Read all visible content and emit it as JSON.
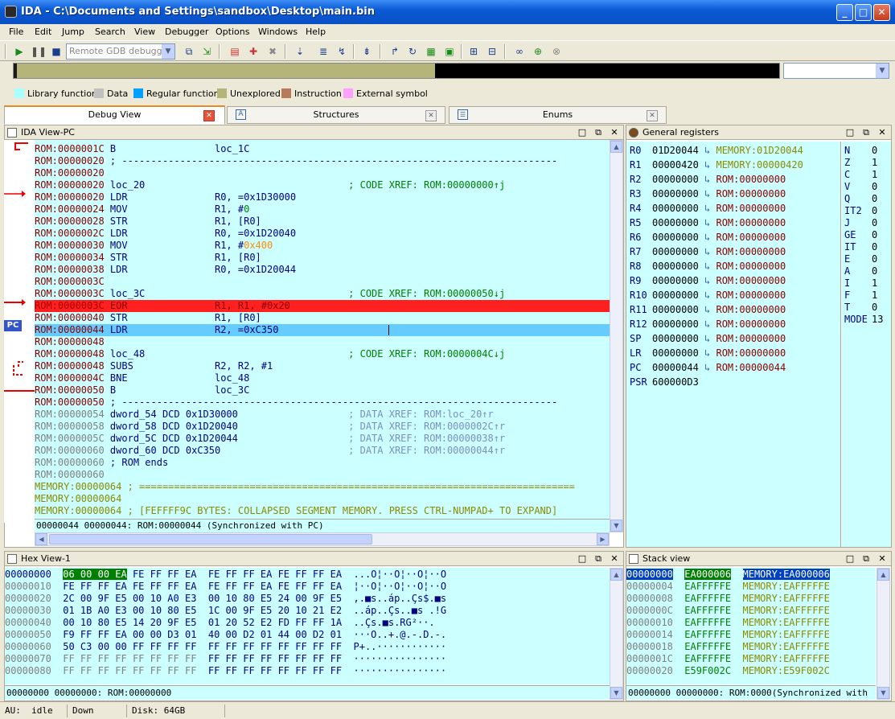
{
  "window": {
    "title": "IDA - C:\\Documents and Settings\\sandbox\\Desktop\\main.bin",
    "min": "_",
    "max": "□",
    "close": "✕"
  },
  "menu": [
    "File",
    "Edit",
    "Jump",
    "Search",
    "View",
    "Debugger",
    "Options",
    "Windows",
    "Help"
  ],
  "toolbar": {
    "debugger_select": "Remote GDB debugger"
  },
  "legend": [
    {
      "label": "Library function",
      "color": "#aaffff"
    },
    {
      "label": "Data",
      "color": "#c0c0c0"
    },
    {
      "label": "Regular function",
      "color": "#00a0ff"
    },
    {
      "label": "Unexplored",
      "color": "#b5b57a"
    },
    {
      "label": "Instruction",
      "color": "#b57b5a"
    },
    {
      "label": "External symbol",
      "color": "#ffa0ff"
    }
  ],
  "tabs": [
    {
      "label": "Debug View"
    },
    {
      "label": "Structures"
    },
    {
      "label": "Enums"
    }
  ],
  "ida_view": {
    "title": "IDA View-PC",
    "pc_label": "PC",
    "status": "00000044 00000044: ROM:00000044 (Synchronized with PC)",
    "lines": [
      {
        "addr": "ROM:0000001C",
        "text": " B                 loc_1C",
        "ac": "c-addr"
      },
      {
        "addr": "ROM:00000020",
        "text": " ; ---------------------------------------------------------------------------",
        "ac": "c-addr"
      },
      {
        "addr": "ROM:00000020",
        "text": "",
        "ac": "c-addr"
      },
      {
        "addr": "ROM:00000020",
        "text": " loc_20                                   ",
        "cmt": "; CODE XREF: ROM:00000000↑j",
        "ac": "c-addr"
      },
      {
        "addr": "ROM:00000020",
        "text": " LDR               R0, =0x1D30000",
        "ac": "c-addr"
      },
      {
        "addr": "ROM:00000024",
        "text": " MOV               R1, #",
        "num": "0",
        "ac": "c-addr"
      },
      {
        "addr": "ROM:00000028",
        "text": " STR               R1, [R0]",
        "ac": "c-addr"
      },
      {
        "addr": "ROM:0000002C",
        "text": " LDR               R0, =0x1D20040",
        "ac": "c-addr"
      },
      {
        "addr": "ROM:00000030",
        "text": " MOV               R1, #",
        "org": "0x400",
        "ac": "c-addr"
      },
      {
        "addr": "ROM:00000034",
        "text": " STR               R1, [R0]",
        "ac": "c-addr"
      },
      {
        "addr": "ROM:00000038",
        "text": " LDR               R0, =0x1D20044",
        "ac": "c-addr"
      },
      {
        "addr": "ROM:0000003C",
        "text": "",
        "ac": "c-addr"
      },
      {
        "addr": "ROM:0000003C",
        "text": " loc_3C                                   ",
        "cmt": "; CODE XREF: ROM:00000050↓j",
        "ac": "c-addr"
      },
      {
        "addr": "ROM:0000003C",
        "text": " EOR               R1, R1, #0x20",
        "ac": "c-addr",
        "hl": "red"
      },
      {
        "addr": "ROM:00000040",
        "text": " STR               R1, [R0]",
        "ac": "c-addr"
      },
      {
        "addr": "ROM:00000044",
        "text": " LDR               R2, =0xC350",
        "ac": "c-addr",
        "hl": "blue"
      },
      {
        "addr": "ROM:00000048",
        "text": "",
        "ac": "c-addr"
      },
      {
        "addr": "ROM:00000048",
        "text": " loc_48                                   ",
        "cmt": "; CODE XREF: ROM:0000004C↓j",
        "ac": "c-addr"
      },
      {
        "addr": "ROM:00000048",
        "text": " SUBS              R2, R2, #1",
        "ac": "c-addr"
      },
      {
        "addr": "ROM:0000004C",
        "text": " BNE               loc_48",
        "ac": "c-addr"
      },
      {
        "addr": "ROM:00000050",
        "text": " B                 loc_3C",
        "ac": "c-addr"
      },
      {
        "addr": "ROM:00000050",
        "text": " ; ---------------------------------------------------------------------------",
        "ac": "c-addr"
      },
      {
        "addr": "ROM:00000054",
        "text": " dword_54 DCD 0x1D30000                   ",
        "cmt2": "; DATA XREF: ROM:loc_20↑r",
        "ac": "c-addr2"
      },
      {
        "addr": "ROM:00000058",
        "text": " dword_58 DCD 0x1D20040                   ",
        "cmt2": "; DATA XREF: ROM:0000002C↑r",
        "ac": "c-addr2"
      },
      {
        "addr": "ROM:0000005C",
        "text": " dword_5C DCD 0x1D20044                   ",
        "cmt2": "; DATA XREF: ROM:00000038↑r",
        "ac": "c-addr2"
      },
      {
        "addr": "ROM:00000060",
        "text": " dword_60 DCD 0xC350                      ",
        "cmt2": "; DATA XREF: ROM:00000044↑r",
        "ac": "c-addr2"
      },
      {
        "addr": "ROM:00000060",
        "text": " ; ROM ends",
        "ac": "c-addr2"
      },
      {
        "addr": "ROM:00000060",
        "text": "",
        "ac": "c-addr2"
      },
      {
        "addr": "MEMORY:00000064",
        "text": " ; ===========================================================================",
        "ac": "c-mem"
      },
      {
        "addr": "MEMORY:00000064",
        "text": "",
        "ac": "c-mem"
      },
      {
        "addr": "MEMORY:00000064",
        "text": " ; [FEFFFF9C BYTES: COLLAPSED SEGMENT MEMORY. PRESS CTRL-NUMPAD+ TO EXPAND]",
        "ac": "c-mem"
      }
    ]
  },
  "registers": {
    "title": "General registers",
    "rows": [
      {
        "name": "R0",
        "value": "01D20044",
        "ref": "MEMORY:01D20044",
        "refcolor": "#8b8b00"
      },
      {
        "name": "R1",
        "value": "00000420",
        "ref": "MEMORY:00000420",
        "refcolor": "#8b8b00"
      },
      {
        "name": "R2",
        "value": "00000000",
        "ref": "ROM:00000000",
        "refcolor": "#8b0000"
      },
      {
        "name": "R3",
        "value": "00000000",
        "ref": "ROM:00000000",
        "refcolor": "#8b0000"
      },
      {
        "name": "R4",
        "value": "00000000",
        "ref": "ROM:00000000",
        "refcolor": "#8b0000"
      },
      {
        "name": "R5",
        "value": "00000000",
        "ref": "ROM:00000000",
        "refcolor": "#8b0000"
      },
      {
        "name": "R6",
        "value": "00000000",
        "ref": "ROM:00000000",
        "refcolor": "#8b0000"
      },
      {
        "name": "R7",
        "value": "00000000",
        "ref": "ROM:00000000",
        "refcolor": "#8b0000"
      },
      {
        "name": "R8",
        "value": "00000000",
        "ref": "ROM:00000000",
        "refcolor": "#8b0000"
      },
      {
        "name": "R9",
        "value": "00000000",
        "ref": "ROM:00000000",
        "refcolor": "#8b0000"
      },
      {
        "name": "R10",
        "value": "00000000",
        "ref": "ROM:00000000",
        "refcolor": "#8b0000"
      },
      {
        "name": "R11",
        "value": "00000000",
        "ref": "ROM:00000000",
        "refcolor": "#8b0000"
      },
      {
        "name": "R12",
        "value": "00000000",
        "ref": "ROM:00000000",
        "refcolor": "#8b0000"
      },
      {
        "name": "SP",
        "value": "00000000",
        "ref": "ROM:00000000",
        "refcolor": "#8b0000"
      },
      {
        "name": "LR",
        "value": "00000000",
        "ref": "ROM:00000000",
        "refcolor": "#8b0000"
      },
      {
        "name": "PC",
        "value": "00000044",
        "ref": "ROM:00000044",
        "refcolor": "#8b0000"
      },
      {
        "name": "PSR",
        "value": "600000D3",
        "ref": "",
        "refcolor": "#8b0000"
      }
    ],
    "flags": [
      {
        "name": "N",
        "value": "0"
      },
      {
        "name": "Z",
        "value": "1"
      },
      {
        "name": "C",
        "value": "1"
      },
      {
        "name": "V",
        "value": "0"
      },
      {
        "name": "Q",
        "value": "0"
      },
      {
        "name": "IT2",
        "value": "0"
      },
      {
        "name": "J",
        "value": "0"
      },
      {
        "name": "GE",
        "value": "0"
      },
      {
        "name": "IT",
        "value": "0"
      },
      {
        "name": "E",
        "value": "0"
      },
      {
        "name": "A",
        "value": "0"
      },
      {
        "name": "I",
        "value": "1"
      },
      {
        "name": "F",
        "value": "1"
      },
      {
        "name": "T",
        "value": "0"
      },
      {
        "name": "MODE",
        "value": "13"
      }
    ]
  },
  "hex_view": {
    "title": "Hex View-1",
    "status": "00000000 00000000: ROM:00000000",
    "rows": [
      {
        "addr": "00000000",
        "b1": "06 00 00 EA FE FF FF EA",
        "b2": "FE FF FF EA FE FF FF EA",
        "ascii": "...O¦··O¦··O¦··O"
      },
      {
        "addr": "00000010",
        "b1": "FE FF FF EA FE FF FF EA",
        "b2": "FE FF FF EA FE FF FF EA",
        "ascii": "¦··O¦··O¦··O¦··O"
      },
      {
        "addr": "00000020",
        "b1": "2C 00 9F E5 00 10 A0 E3",
        "b2": "00 10 80 E5 24 00 9F E5",
        "ascii": ",.■s..áp..Çs$.■s"
      },
      {
        "addr": "00000030",
        "b1": "01 1B A0 E3 00 10 80 E5",
        "b2": "1C 00 9F E5 20 10 21 E2",
        "ascii": "..áp..Çs..■s .!G"
      },
      {
        "addr": "00000040",
        "b1": "00 10 80 E5 14 20 9F E5",
        "b2": "01 20 52 E2 FD FF FF 1A",
        "ascii": "..Çs.■s.RG²··."
      },
      {
        "addr": "00000050",
        "b1": "F9 FF FF EA 00 00 D3 01",
        "b2": "40 00 D2 01 44 00 D2 01",
        "ascii": "···O..+.@.-.D.-."
      },
      {
        "addr": "00000060",
        "b1": "50 C3 00 00 FF FF FF FF",
        "b2": "FF FF FF FF FF FF FF FF",
        "ascii": "P+..············"
      },
      {
        "addr": "00000070",
        "b1": "FF FF FF FF FF FF FF FF",
        "b2": "FF FF FF FF FF FF FF FF",
        "ascii": "················"
      },
      {
        "addr": "00000080",
        "b1": "FF FF FF FF FF FF FF FF",
        "b2": "FF FF FF FF FF FF FF FF",
        "ascii": "················"
      }
    ]
  },
  "stack_view": {
    "title": "Stack view",
    "status": "00000000 00000000: ROM:0000(Synchronized with",
    "rows": [
      {
        "addr": "00000000",
        "value": "EA000006",
        "ref": "MEMORY:EA000006"
      },
      {
        "addr": "00000004",
        "value": "EAFFFFFE",
        "ref": "MEMORY:EAFFFFFE"
      },
      {
        "addr": "00000008",
        "value": "EAFFFFFE",
        "ref": "MEMORY:EAFFFFFE"
      },
      {
        "addr": "0000000C",
        "value": "EAFFFFFE",
        "ref": "MEMORY:EAFFFFFE"
      },
      {
        "addr": "00000010",
        "value": "EAFFFFFE",
        "ref": "MEMORY:EAFFFFFE"
      },
      {
        "addr": "00000014",
        "value": "EAFFFFFE",
        "ref": "MEMORY:EAFFFFFE"
      },
      {
        "addr": "00000018",
        "value": "EAFFFFFE",
        "ref": "MEMORY:EAFFFFFE"
      },
      {
        "addr": "0000001C",
        "value": "EAFFFFFE",
        "ref": "MEMORY:EAFFFFFE"
      },
      {
        "addr": "00000020",
        "value": "E59F002C",
        "ref": "MEMORY:E59F002C"
      }
    ]
  },
  "status": {
    "au": "AU:",
    "state": "idle",
    "dir": "Down",
    "disk": "Disk: 64GB"
  }
}
